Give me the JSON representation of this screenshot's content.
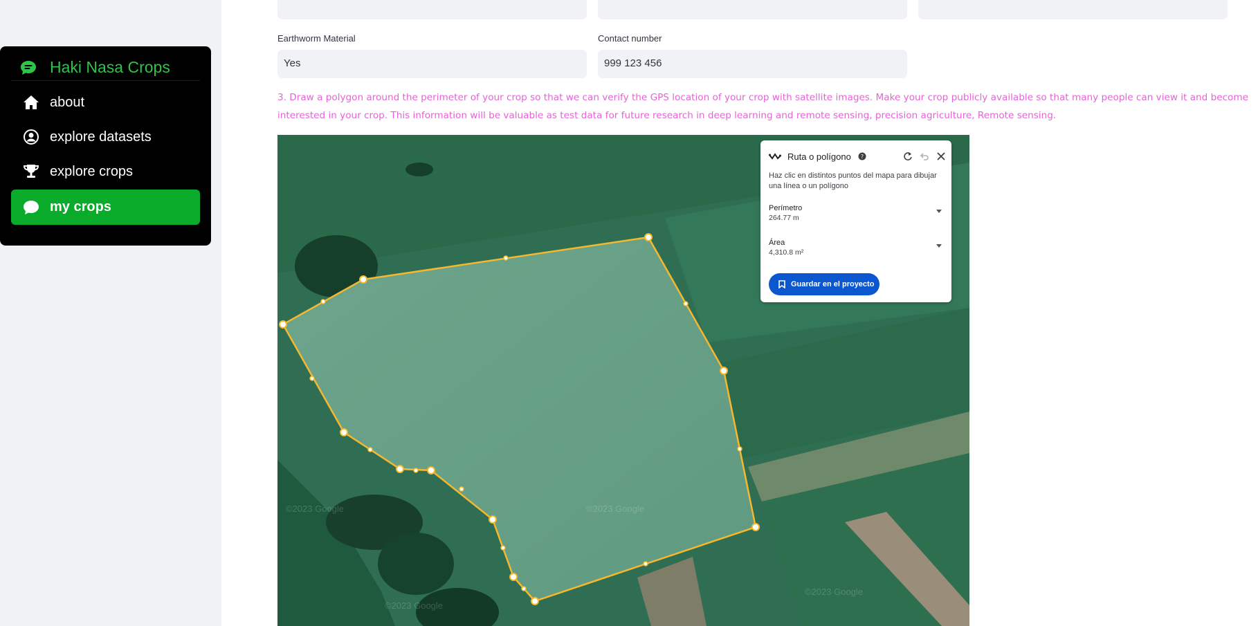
{
  "sidebar": {
    "brand": "Haki Nasa Crops",
    "items": [
      {
        "label": "about",
        "icon": "house-icon"
      },
      {
        "label": "explore datasets",
        "icon": "user-circle-icon"
      },
      {
        "label": "explore crops",
        "icon": "trophy-icon"
      },
      {
        "label": "my crops",
        "icon": "chat-bubble-icon",
        "active": true
      }
    ]
  },
  "form": {
    "earthworm_label": "Earthworm Material",
    "earthworm_value": "Yes",
    "contact_label": "Contact number",
    "contact_value": "999 123 456",
    "instruction": "3. Draw a polygon around the perimeter of your crop so that we can verify the GPS location of your crop with satellite images. Make your crop publicly available so that many people can view it and become interested in your crop. This information will be valuable as test data for future research in deep learning and remote sensing, precision agriculture, Remote sensing."
  },
  "map_panel": {
    "title": "Ruta o polígono",
    "description": "Haz clic en distintos puntos del mapa para dibujar una línea o un polígono",
    "perimeter_label": "Perímetro",
    "perimeter_value": "264.77 m",
    "area_label": "Área",
    "area_value": "4,310.8 m²",
    "save_button": "Guardar en el proyecto"
  },
  "map": {
    "watermark": "©2023 Google",
    "polygon_color": "#f5b82e"
  },
  "colors": {
    "brand_green": "#2ec44a",
    "active_green": "#0aaa2a",
    "instruction_pink": "#e464d6",
    "button_blue": "#0b57d0"
  }
}
